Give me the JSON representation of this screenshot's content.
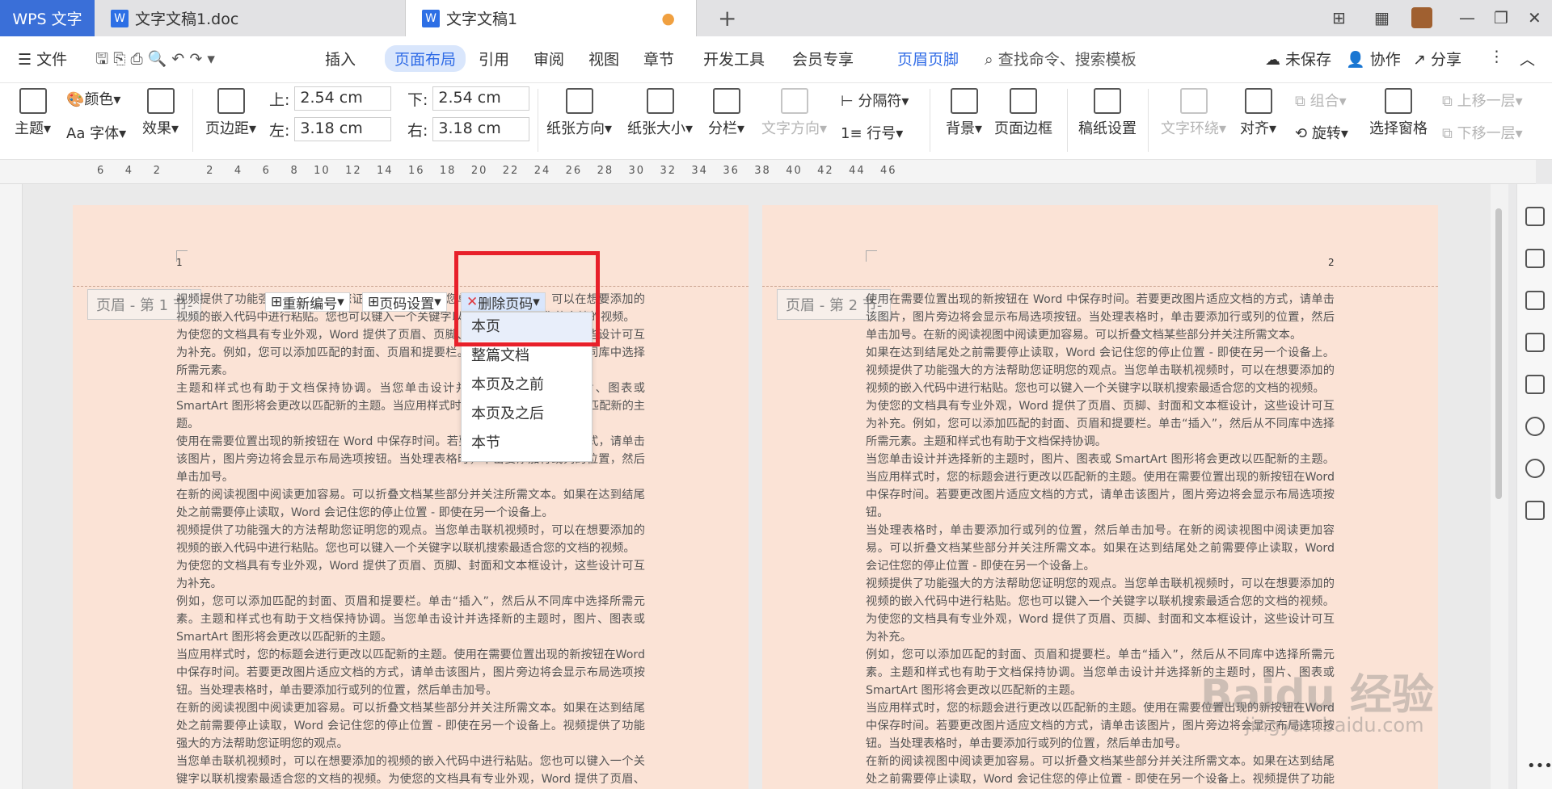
{
  "tabs": {
    "app": "WPS 文字",
    "doc1": "文字文稿1.doc",
    "doc2": "文字文稿1"
  },
  "menu": {
    "file": "文件",
    "items": [
      "插入",
      "页面布局",
      "引用",
      "审阅",
      "视图",
      "章节",
      "开发工具",
      "会员专享",
      "页眉页脚"
    ],
    "search": "查找命令、搜索模板",
    "unsaved": "未保存",
    "collab": "协作",
    "share": "分享"
  },
  "toolbar": {
    "theme": "主题",
    "color": "颜色",
    "font": "字体",
    "effect": "效果",
    "margin": "页边距",
    "top_label": "上:",
    "top_val": "2.54 cm",
    "bottom_label": "下:",
    "bottom_val": "2.54 cm",
    "left_label": "左:",
    "left_val": "3.18 cm",
    "right_label": "右:",
    "right_val": "3.18 cm",
    "orient": "纸张方向",
    "size": "纸张大小",
    "columns": "分栏",
    "text_dir": "文字方向",
    "separator": "分隔符",
    "line_no": "行号",
    "background": "背景",
    "border": "页面边框",
    "grid": "稿纸设置",
    "wrap": "文字环绕",
    "align": "对齐",
    "group": "组合",
    "rotate": "旋转",
    "select": "选择窗格",
    "up": "上移一层",
    "down": "下移一层"
  },
  "ruler": "6    4    2         2    4    6    8   10   12   14   16   18   20   22   24   26   28   30   32   34   36   38   40   42   44   46",
  "page1": {
    "header_tag": "页眉  - 第 1 节-",
    "num": "1"
  },
  "page2": {
    "header_tag": "页眉  - 第 2 节-",
    "num": "2"
  },
  "pg_toolbar": {
    "renumber": "重新编号",
    "setting": "页码设置",
    "delete": "删除页码"
  },
  "dropdown": [
    "本页",
    "整篇文档",
    "本页及之前",
    "本页及之后",
    "本节"
  ],
  "text1": [
    "视频提供了功能强大的方法帮助您证明您的观点。当您单击联机视频时，可以在想要添加的视频的嵌入代码中进行粘贴。您也可以键入一个关键字以联机搜索最适合您的文档的视频。",
    "为使您的文档具有专业外观，Word 提供了页眉、页脚、封面和文本框设计，这些设计可互为补充。例如，您可以添加匹配的封面、页眉和提要栏。单击“插入”，然后从不同库中选择所需元素。",
    "主题和样式也有助于文档保持协调。当您单击设计并选择新的主题时，图片、图表或SmartArt 图形将会更改以匹配新的主题。当应用样式时，您的标题会进行更改以匹配新的主题。",
    "使用在需要位置出现的新按钮在 Word 中保存时间。若要更改图片适应文档的方式，请单击该图片，图片旁边将会显示布局选项按钮。当处理表格时，单击要添加行或列的位置，然后单击加号。",
    "在新的阅读视图中阅读更加容易。可以折叠文档某些部分并关注所需文本。如果在达到结尾处之前需要停止读取，Word 会记住您的停止位置 - 即使在另一个设备上。",
    "视频提供了功能强大的方法帮助您证明您的观点。当您单击联机视频时，可以在想要添加的视频的嵌入代码中进行粘贴。您也可以键入一个关键字以联机搜索最适合您的文档的视频。",
    "为使您的文档具有专业外观，Word 提供了页眉、页脚、封面和文本框设计，这些设计可互为补充。",
    "例如，您可以添加匹配的封面、页眉和提要栏。单击“插入”，然后从不同库中选择所需元素。主题和样式也有助于文档保持协调。当您单击设计并选择新的主题时，图片、图表或SmartArt 图形将会更改以匹配新的主题。",
    "当应用样式时，您的标题会进行更改以匹配新的主题。使用在需要位置出现的新按钮在Word 中保存时间。若要更改图片适应文档的方式，请单击该图片，图片旁边将会显示布局选项按钮。当处理表格时，单击要添加行或列的位置，然后单击加号。",
    "在新的阅读视图中阅读更加容易。可以折叠文档某些部分并关注所需文本。如果在达到结尾处之前需要停止读取，Word 会记住您的停止位置 - 即使在另一个设备上。视频提供了功能强大的方法帮助您证明您的观点。",
    "当您单击联机视频时，可以在想要添加的视频的嵌入代码中进行粘贴。您也可以键入一个关键字以联机搜索最适合您的文档的视频。为使您的文档具有专业外观，Word 提供了页眉、页脚、封面和文本框设计，这些设计可互为补充。例如，您可以添加匹配的封面、页眉和提"
  ],
  "text2": [
    "使用在需要位置出现的新按钮在 Word 中保存时间。若要更改图片适应文档的方式，请单击该图片，图片旁边将会显示布局选项按钮。当处理表格时，单击要添加行或列的位置，然后单击加号。在新的阅读视图中阅读更加容易。可以折叠文档某些部分并关注所需文本。",
    "如果在达到结尾处之前需要停止读取，Word 会记住您的停止位置 - 即使在另一个设备上。视频提供了功能强大的方法帮助您证明您的观点。当您单击联机视频时，可以在想要添加的视频的嵌入代码中进行粘贴。您也可以键入一个关键字以联机搜索最适合您的文档的视频。",
    "为使您的文档具有专业外观，Word 提供了页眉、页脚、封面和文本框设计，这些设计可互为补充。例如，您可以添加匹配的封面、页眉和提要栏。单击“插入”，然后从不同库中选择所需元素。主题和样式也有助于文档保持协调。",
    "当您单击设计并选择新的主题时，图片、图表或 SmartArt 图形将会更改以匹配新的主题。当应用样式时，您的标题会进行更改以匹配新的主题。使用在需要位置出现的新按钮在Word 中保存时间。若要更改图片适应文档的方式，请单击该图片，图片旁边将会显示布局选项按钮。",
    "当处理表格时，单击要添加行或列的位置，然后单击加号。在新的阅读视图中阅读更加容易。可以折叠文档某些部分并关注所需文本。如果在达到结尾处之前需要停止读取，Word 会记住您的停止位置 - 即使在另一个设备上。",
    "视频提供了功能强大的方法帮助您证明您的观点。当您单击联机视频时，可以在想要添加的视频的嵌入代码中进行粘贴。您也可以键入一个关键字以联机搜索最适合您的文档的视频。为使您的文档具有专业外观，Word 提供了页眉、页脚、封面和文本框设计，这些设计可互为补充。",
    "例如，您可以添加匹配的封面、页眉和提要栏。单击“插入”，然后从不同库中选择所需元素。主题和样式也有助于文档保持协调。当您单击设计并选择新的主题时，图片、图表或SmartArt 图形将会更改以匹配新的主题。",
    "当应用样式时，您的标题会进行更改以匹配新的主题。使用在需要位置出现的新按钮在Word 中保存时间。若要更改图片适应文档的方式，请单击该图片，图片旁边将会显示布局选项按钮。当处理表格时，单击要添加行或列的位置，然后单击加号。",
    "在新的阅读视图中阅读更加容易。可以折叠文档某些部分并关注所需文本。如果在达到结尾处之前需要停止读取，Word 会记住您的停止位置 - 即使在另一个设备上。视频提供了功能强大的方法"
  ],
  "watermark": "Baidu 经验",
  "watermark_sub": "jingyan.baidu.com"
}
